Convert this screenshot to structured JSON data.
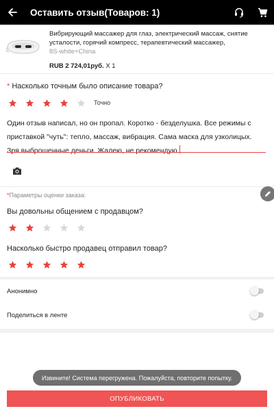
{
  "header": {
    "title": "Оставить отзыв(Товаров: 1)",
    "back_icon": "arrow-left-icon",
    "support_icon": "headset-icon",
    "cart_icon": "cart-icon"
  },
  "product": {
    "name": "Вибрирующий массажер для глаз, электрический массаж, снятие усталости, горячий компресс, терапевтический массажер, музыкальная ...",
    "variant": "8S-white+China",
    "price": "RUB 2 724,01руб.",
    "quantity": "X 1"
  },
  "accuracy": {
    "required_mark": "*",
    "question": "Насколько точным было описание товара?",
    "rating": 4,
    "max": 5,
    "rating_label": "Точно"
  },
  "review": {
    "text": "Один отзыв написал, но он пропал. Коротко - безделушка. Все режимы с приставкой \"чуть\": тепло, массаж, вибрация. Сама маска для узколицых. Зря выброшенные деньги. Жалею, не рекомендую."
  },
  "order_params": {
    "required_mark": "*",
    "label": "Параметры оценки заказа:"
  },
  "seller_communication": {
    "question": "Вы довольны общением с продавцом?",
    "rating": 2,
    "max": 5
  },
  "shipping_speed": {
    "question": "Насколько быстро продавец отправил товар?",
    "rating": 5,
    "max": 5
  },
  "options": {
    "anonymous": {
      "label": "Анонимно",
      "enabled": false
    },
    "share_feed": {
      "label": "Поделиться в ленте",
      "enabled": false
    }
  },
  "toast": {
    "text": "Извините! Система перегружена. Пожалуйста, повторите попытку."
  },
  "publish_button": {
    "label": "ОПУБЛИКОВАТЬ"
  },
  "colors": {
    "star_active": "#e64340",
    "star_inactive": "#d8d8d8",
    "accent": "#f05454",
    "header_bg": "#000000"
  }
}
